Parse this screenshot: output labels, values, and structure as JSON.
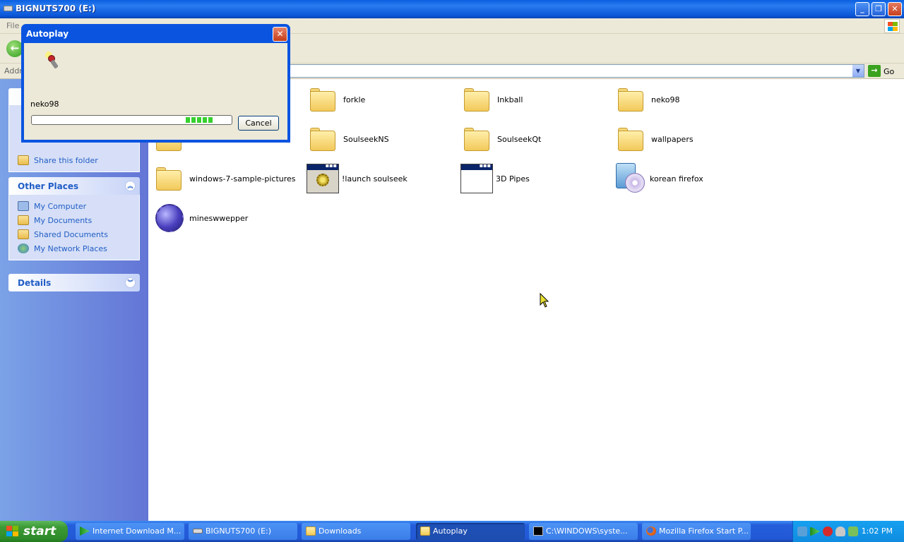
{
  "window": {
    "title": "BIGNUTS700 (E:)",
    "menu_first": "File",
    "address_label": "Addre",
    "go_label": "Go"
  },
  "left_pane": {
    "file_tasks": {
      "share_label": "Share this folder"
    },
    "other_places": {
      "title": "Other Places",
      "items": [
        "My Computer",
        "My Documents",
        "Shared Documents",
        "My Network Places"
      ]
    },
    "details": {
      "title": "Details"
    }
  },
  "items": [
    {
      "name": "forkle",
      "type": "folder"
    },
    {
      "name": "Inkball",
      "type": "folder"
    },
    {
      "name": "neko98",
      "type": "folder"
    },
    {
      "name": "SoulseekNS",
      "type": "folder"
    },
    {
      "name": "SoulseekQt",
      "type": "folder"
    },
    {
      "name": "wallpapers",
      "type": "folder"
    },
    {
      "name": "windows-7-sample-pictures",
      "type": "folder"
    },
    {
      "name": "!launch soulseek",
      "type": "batch-file"
    },
    {
      "name": "3D Pipes",
      "type": "application"
    },
    {
      "name": "korean firefox",
      "type": "setup-cd"
    },
    {
      "name": "mineswwepper",
      "type": "mine"
    }
  ],
  "autoplay": {
    "title": "Autoplay",
    "item_name": "neko98",
    "cancel_label": "Cancel"
  },
  "taskbar": {
    "start_label": "start",
    "buttons": [
      {
        "label": "Internet Download M...",
        "active": false,
        "icon": "idm-arrow-icon"
      },
      {
        "label": "BIGNUTS700 (E:)",
        "active": false,
        "icon": "drive-icon"
      },
      {
        "label": "Downloads",
        "active": false,
        "icon": "folder-icon"
      },
      {
        "label": "Autoplay",
        "active": true,
        "icon": "folder-icon"
      },
      {
        "label": "C:\\WINDOWS\\syste...",
        "active": false,
        "icon": "console-icon"
      },
      {
        "label": "Mozilla Firefox Start P...",
        "active": false,
        "icon": "firefox-icon"
      }
    ],
    "clock": "1:02 PM"
  },
  "colors": {
    "xp_blue": "#0a54e0",
    "taskpane_link": "#215dc6",
    "start_green": "#3c9a36"
  }
}
